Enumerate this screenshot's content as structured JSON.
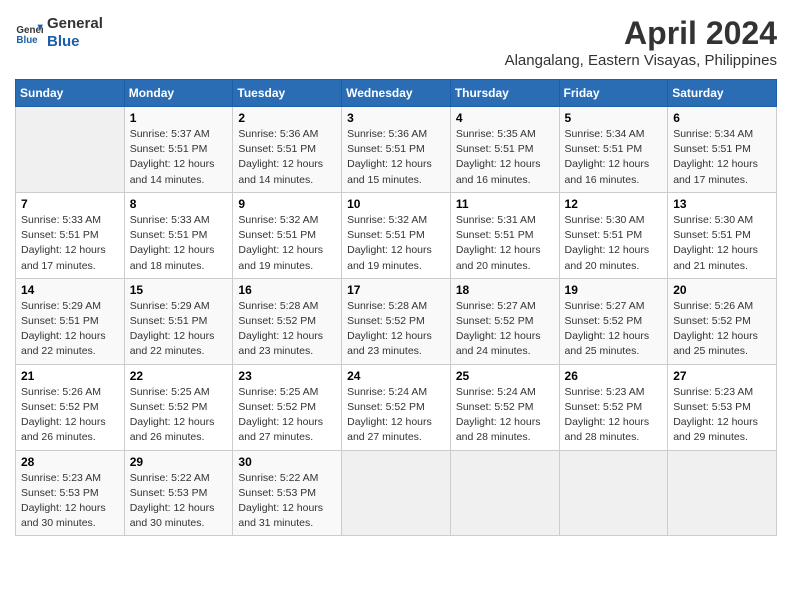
{
  "header": {
    "logo_line1": "General",
    "logo_line2": "Blue",
    "month": "April 2024",
    "location": "Alangalang, Eastern Visayas, Philippines"
  },
  "weekdays": [
    "Sunday",
    "Monday",
    "Tuesday",
    "Wednesday",
    "Thursday",
    "Friday",
    "Saturday"
  ],
  "weeks": [
    [
      {
        "num": "",
        "detail": ""
      },
      {
        "num": "1",
        "detail": "Sunrise: 5:37 AM\nSunset: 5:51 PM\nDaylight: 12 hours\nand 14 minutes."
      },
      {
        "num": "2",
        "detail": "Sunrise: 5:36 AM\nSunset: 5:51 PM\nDaylight: 12 hours\nand 14 minutes."
      },
      {
        "num": "3",
        "detail": "Sunrise: 5:36 AM\nSunset: 5:51 PM\nDaylight: 12 hours\nand 15 minutes."
      },
      {
        "num": "4",
        "detail": "Sunrise: 5:35 AM\nSunset: 5:51 PM\nDaylight: 12 hours\nand 16 minutes."
      },
      {
        "num": "5",
        "detail": "Sunrise: 5:34 AM\nSunset: 5:51 PM\nDaylight: 12 hours\nand 16 minutes."
      },
      {
        "num": "6",
        "detail": "Sunrise: 5:34 AM\nSunset: 5:51 PM\nDaylight: 12 hours\nand 17 minutes."
      }
    ],
    [
      {
        "num": "7",
        "detail": "Sunrise: 5:33 AM\nSunset: 5:51 PM\nDaylight: 12 hours\nand 17 minutes."
      },
      {
        "num": "8",
        "detail": "Sunrise: 5:33 AM\nSunset: 5:51 PM\nDaylight: 12 hours\nand 18 minutes."
      },
      {
        "num": "9",
        "detail": "Sunrise: 5:32 AM\nSunset: 5:51 PM\nDaylight: 12 hours\nand 19 minutes."
      },
      {
        "num": "10",
        "detail": "Sunrise: 5:32 AM\nSunset: 5:51 PM\nDaylight: 12 hours\nand 19 minutes."
      },
      {
        "num": "11",
        "detail": "Sunrise: 5:31 AM\nSunset: 5:51 PM\nDaylight: 12 hours\nand 20 minutes."
      },
      {
        "num": "12",
        "detail": "Sunrise: 5:30 AM\nSunset: 5:51 PM\nDaylight: 12 hours\nand 20 minutes."
      },
      {
        "num": "13",
        "detail": "Sunrise: 5:30 AM\nSunset: 5:51 PM\nDaylight: 12 hours\nand 21 minutes."
      }
    ],
    [
      {
        "num": "14",
        "detail": "Sunrise: 5:29 AM\nSunset: 5:51 PM\nDaylight: 12 hours\nand 22 minutes."
      },
      {
        "num": "15",
        "detail": "Sunrise: 5:29 AM\nSunset: 5:51 PM\nDaylight: 12 hours\nand 22 minutes."
      },
      {
        "num": "16",
        "detail": "Sunrise: 5:28 AM\nSunset: 5:52 PM\nDaylight: 12 hours\nand 23 minutes."
      },
      {
        "num": "17",
        "detail": "Sunrise: 5:28 AM\nSunset: 5:52 PM\nDaylight: 12 hours\nand 23 minutes."
      },
      {
        "num": "18",
        "detail": "Sunrise: 5:27 AM\nSunset: 5:52 PM\nDaylight: 12 hours\nand 24 minutes."
      },
      {
        "num": "19",
        "detail": "Sunrise: 5:27 AM\nSunset: 5:52 PM\nDaylight: 12 hours\nand 25 minutes."
      },
      {
        "num": "20",
        "detail": "Sunrise: 5:26 AM\nSunset: 5:52 PM\nDaylight: 12 hours\nand 25 minutes."
      }
    ],
    [
      {
        "num": "21",
        "detail": "Sunrise: 5:26 AM\nSunset: 5:52 PM\nDaylight: 12 hours\nand 26 minutes."
      },
      {
        "num": "22",
        "detail": "Sunrise: 5:25 AM\nSunset: 5:52 PM\nDaylight: 12 hours\nand 26 minutes."
      },
      {
        "num": "23",
        "detail": "Sunrise: 5:25 AM\nSunset: 5:52 PM\nDaylight: 12 hours\nand 27 minutes."
      },
      {
        "num": "24",
        "detail": "Sunrise: 5:24 AM\nSunset: 5:52 PM\nDaylight: 12 hours\nand 27 minutes."
      },
      {
        "num": "25",
        "detail": "Sunrise: 5:24 AM\nSunset: 5:52 PM\nDaylight: 12 hours\nand 28 minutes."
      },
      {
        "num": "26",
        "detail": "Sunrise: 5:23 AM\nSunset: 5:52 PM\nDaylight: 12 hours\nand 28 minutes."
      },
      {
        "num": "27",
        "detail": "Sunrise: 5:23 AM\nSunset: 5:53 PM\nDaylight: 12 hours\nand 29 minutes."
      }
    ],
    [
      {
        "num": "28",
        "detail": "Sunrise: 5:23 AM\nSunset: 5:53 PM\nDaylight: 12 hours\nand 30 minutes."
      },
      {
        "num": "29",
        "detail": "Sunrise: 5:22 AM\nSunset: 5:53 PM\nDaylight: 12 hours\nand 30 minutes."
      },
      {
        "num": "30",
        "detail": "Sunrise: 5:22 AM\nSunset: 5:53 PM\nDaylight: 12 hours\nand 31 minutes."
      },
      {
        "num": "",
        "detail": ""
      },
      {
        "num": "",
        "detail": ""
      },
      {
        "num": "",
        "detail": ""
      },
      {
        "num": "",
        "detail": ""
      }
    ]
  ]
}
